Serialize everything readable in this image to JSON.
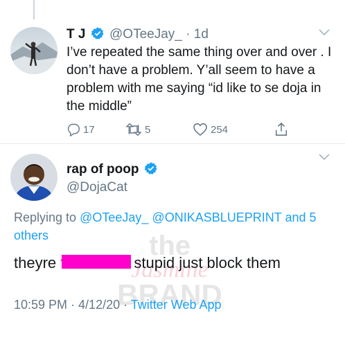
{
  "tweet1": {
    "display_name": "T J",
    "handle": "@OTeeJay_",
    "separator": "·",
    "age": "1d",
    "text": "I’ve repeated the same thing over and over . I don’t have a problem. Y’all seem to have a problem with me saying “id like to se doja in the middle”",
    "replies": "17",
    "retweets": "5",
    "likes": "254"
  },
  "tweet2": {
    "display_name": "rap of poop",
    "handle": "@DojaCat",
    "replying_prefix": "Replying to",
    "mention1": "@OTeeJay_",
    "mention2": "@ONIKASBLUEPRINT",
    "replying_and": "and",
    "replying_others": "5 others",
    "text_before": "theyre f",
    "text_after": "stupid just block them",
    "timestamp": "10:59 PM · 4/12/20 ·",
    "client": "Twitter Web App"
  },
  "watermark": {
    "line1": "the",
    "line2": "Jasmine",
    "line3": "BRAND"
  },
  "colors": {
    "link": "#1da1f2",
    "secondary_text": "#657786",
    "censor_bar": "#ff00cc"
  }
}
